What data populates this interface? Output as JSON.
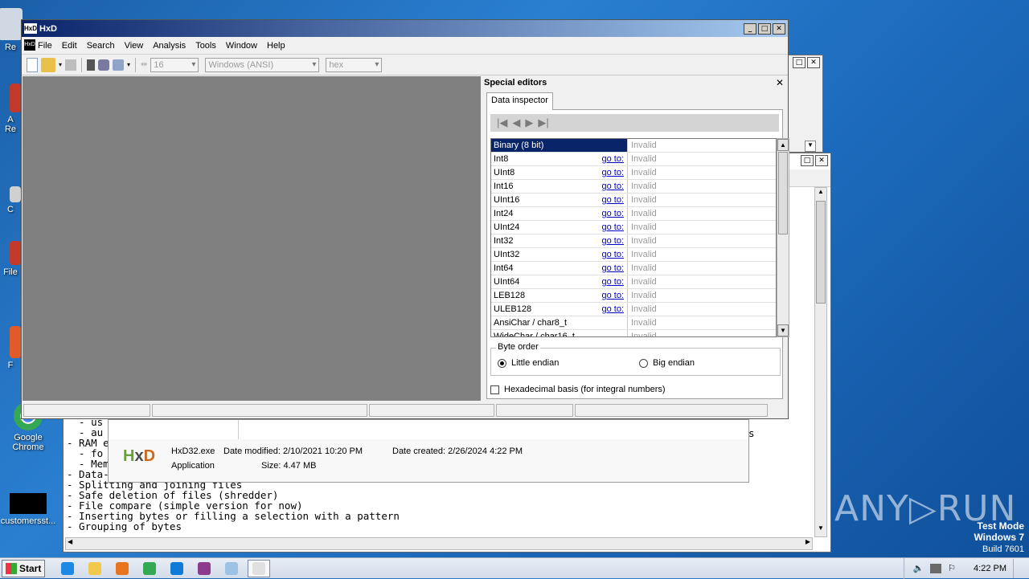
{
  "desktop": {
    "icons": [
      {
        "label": "Re",
        "color": "#cfd8e3"
      },
      {
        "label": "A\nRe",
        "color": "#c0392b"
      },
      {
        "label": "C",
        "color": "#d0d0d0"
      },
      {
        "label": "File",
        "color": "#c0392b"
      },
      {
        "label": "F",
        "color": "#e05a2a"
      },
      {
        "label": "Google Chrome",
        "color": "#4caf50"
      },
      {
        "label": "customersst...",
        "color": "#000000"
      }
    ],
    "watermark": {
      "brand": "ANY▷RUN",
      "mode": "Test Mode",
      "os": "Windows 7",
      "build": "Build 7601"
    }
  },
  "editor_lines": [
    "  - us",
    "  - au",
    "- RAM e",
    "  - fo",
    "  - Mem",
    "- Data-",
    "- Splitting and joining files",
    "- Safe deletion of files (shredder)",
    "- File compare (simple version for now)",
    "- Inserting bytes or filling a selection with a pattern",
    "- Grouping of bytes"
  ],
  "editor_overflow_char": "s",
  "file_tooltip": {
    "name": "HxD32.exe",
    "modified_label": "Date modified: 2/10/2021 10:20 PM",
    "created_label": "Date created: 2/26/2024 4:22 PM",
    "type": "Application",
    "size_label": "Size: 4.47 MB"
  },
  "hxd": {
    "title": "HxD",
    "logo": "HxD",
    "menu": [
      "File",
      "Edit",
      "Search",
      "View",
      "Analysis",
      "Tools",
      "Window",
      "Help"
    ],
    "toolbar": {
      "bytes_per_row": "16",
      "charset": "Windows (ANSI)",
      "offset_base": "hex"
    },
    "special_editors": {
      "title": "Special editors",
      "close": "✕",
      "tab": "Data inspector",
      "rows": [
        {
          "name": "Binary (8 bit)",
          "goto": "",
          "value": "Invalid",
          "selected": true
        },
        {
          "name": "Int8",
          "goto": "go to:",
          "value": "Invalid"
        },
        {
          "name": "UInt8",
          "goto": "go to:",
          "value": "Invalid"
        },
        {
          "name": "Int16",
          "goto": "go to:",
          "value": "Invalid"
        },
        {
          "name": "UInt16",
          "goto": "go to:",
          "value": "Invalid"
        },
        {
          "name": "Int24",
          "goto": "go to:",
          "value": "Invalid"
        },
        {
          "name": "UInt24",
          "goto": "go to:",
          "value": "Invalid"
        },
        {
          "name": "Int32",
          "goto": "go to:",
          "value": "Invalid"
        },
        {
          "name": "UInt32",
          "goto": "go to:",
          "value": "Invalid"
        },
        {
          "name": "Int64",
          "goto": "go to:",
          "value": "Invalid"
        },
        {
          "name": "UInt64",
          "goto": "go to:",
          "value": "Invalid"
        },
        {
          "name": "LEB128",
          "goto": "go to:",
          "value": "Invalid"
        },
        {
          "name": "ULEB128",
          "goto": "go to:",
          "value": "Invalid"
        },
        {
          "name": "AnsiChar / char8_t",
          "goto": "",
          "value": "Invalid"
        },
        {
          "name": "WideChar / char16_t",
          "goto": "",
          "value": "Invalid"
        }
      ],
      "byte_order_label": "Byte order",
      "little_endian": "Little endian",
      "big_endian": "Big endian",
      "hex_basis": "Hexadecimal basis (for integral numbers)"
    }
  },
  "taskbar": {
    "start": "Start",
    "apps": [
      {
        "name": "ie",
        "color": "#1e88e5"
      },
      {
        "name": "explorer",
        "color": "#f2c94c"
      },
      {
        "name": "media",
        "color": "#e8741e"
      },
      {
        "name": "chrome",
        "color": "#34a853"
      },
      {
        "name": "edge",
        "color": "#0f7ad8"
      },
      {
        "name": "winrar",
        "color": "#8e3b8e"
      },
      {
        "name": "notepad",
        "color": "#9cc3e6"
      },
      {
        "name": "hxd",
        "color": "#e0e0e0"
      }
    ],
    "clock": "4:22 PM"
  }
}
